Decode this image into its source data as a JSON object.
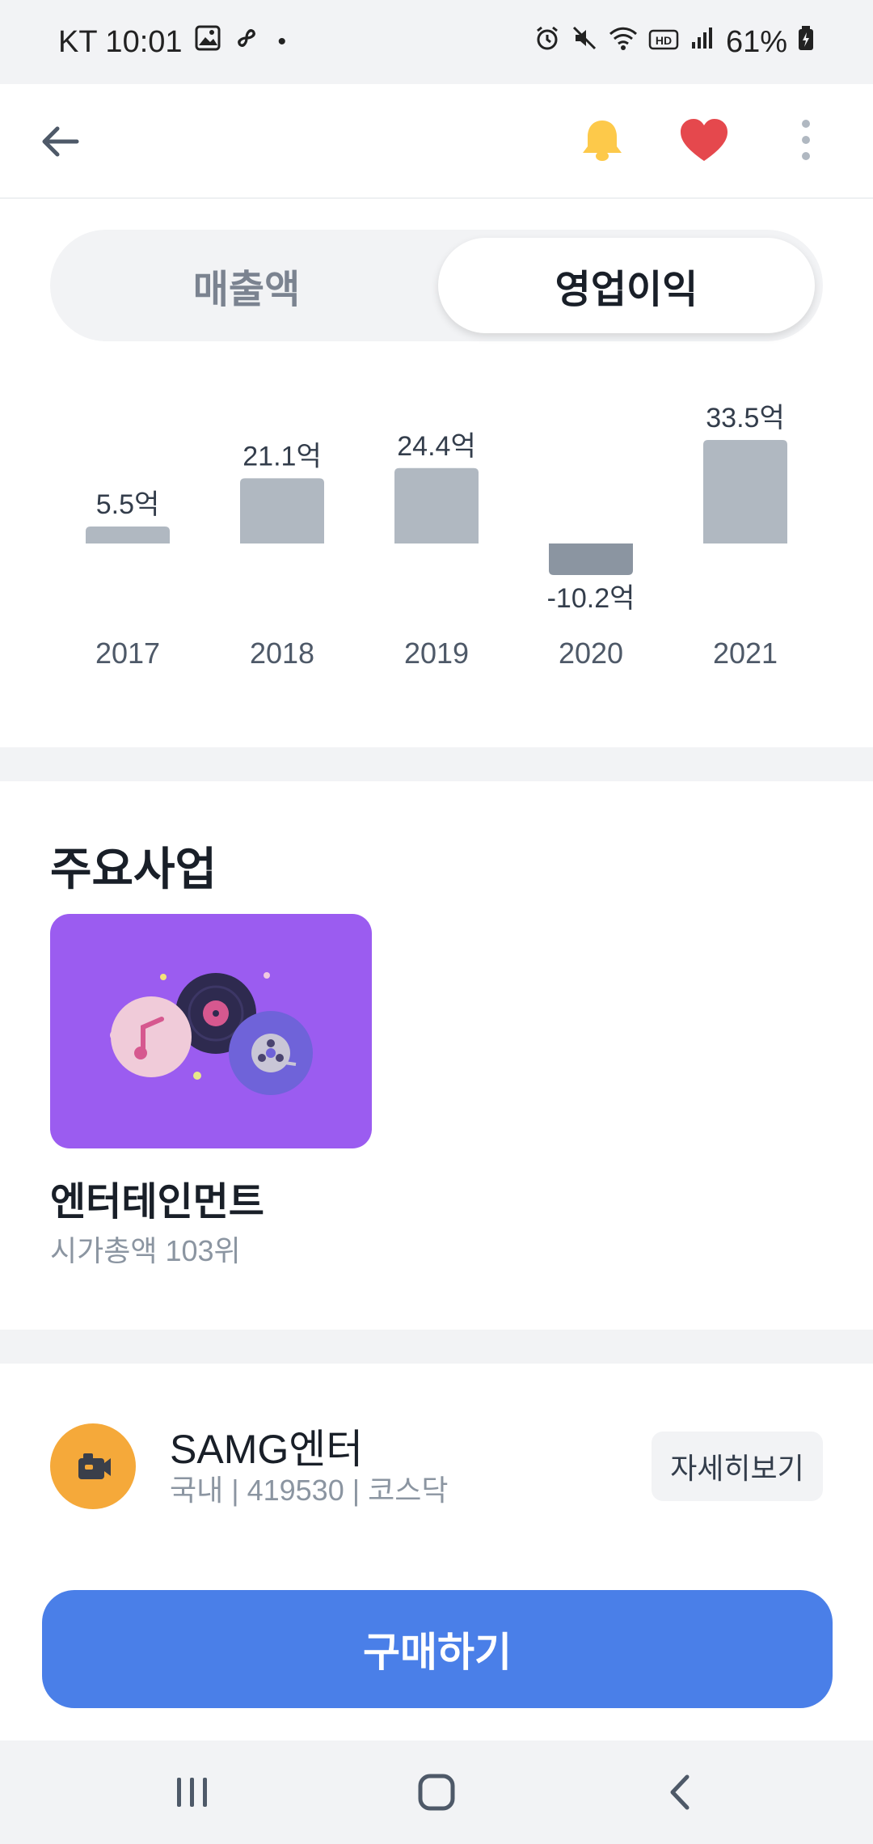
{
  "status_bar": {
    "carrier_time": "KT 10:01",
    "battery": "61%"
  },
  "app_bar": {
    "back_icon": "arrow-left-icon",
    "bell_icon": "bell-icon",
    "heart_icon": "heart-icon",
    "more_icon": "more-vertical-icon"
  },
  "tabs": [
    {
      "label": "매출액",
      "selected": false
    },
    {
      "label": "영업이익",
      "selected": true
    }
  ],
  "chart_data": {
    "type": "bar",
    "categories": [
      "2017",
      "2018",
      "2019",
      "2020",
      "2021"
    ],
    "values": [
      5.5,
      21.1,
      24.4,
      -10.2,
      33.5
    ],
    "data_labels": [
      "5.5억",
      "21.1억",
      "24.4억",
      "-10.2억",
      "33.5억"
    ],
    "unit": "억",
    "colors": {
      "positive": "#b0b8c1",
      "negative": "#8b95a1"
    }
  },
  "business": {
    "title": "주요사업",
    "item_name": "엔터테인먼트",
    "item_sub": "시가총액 103위",
    "card_color": "#9b5cf0"
  },
  "company": {
    "name": "SAMG엔터",
    "meta": "국내 | 419530 | 코스닥",
    "detail_label": "자세히보기"
  },
  "buy": {
    "label": "구매하기",
    "color": "#4a7fe8"
  },
  "nav": {
    "recent_icon": "recent-apps-icon",
    "home_icon": "home-icon",
    "back_icon": "back-chevron-icon"
  }
}
